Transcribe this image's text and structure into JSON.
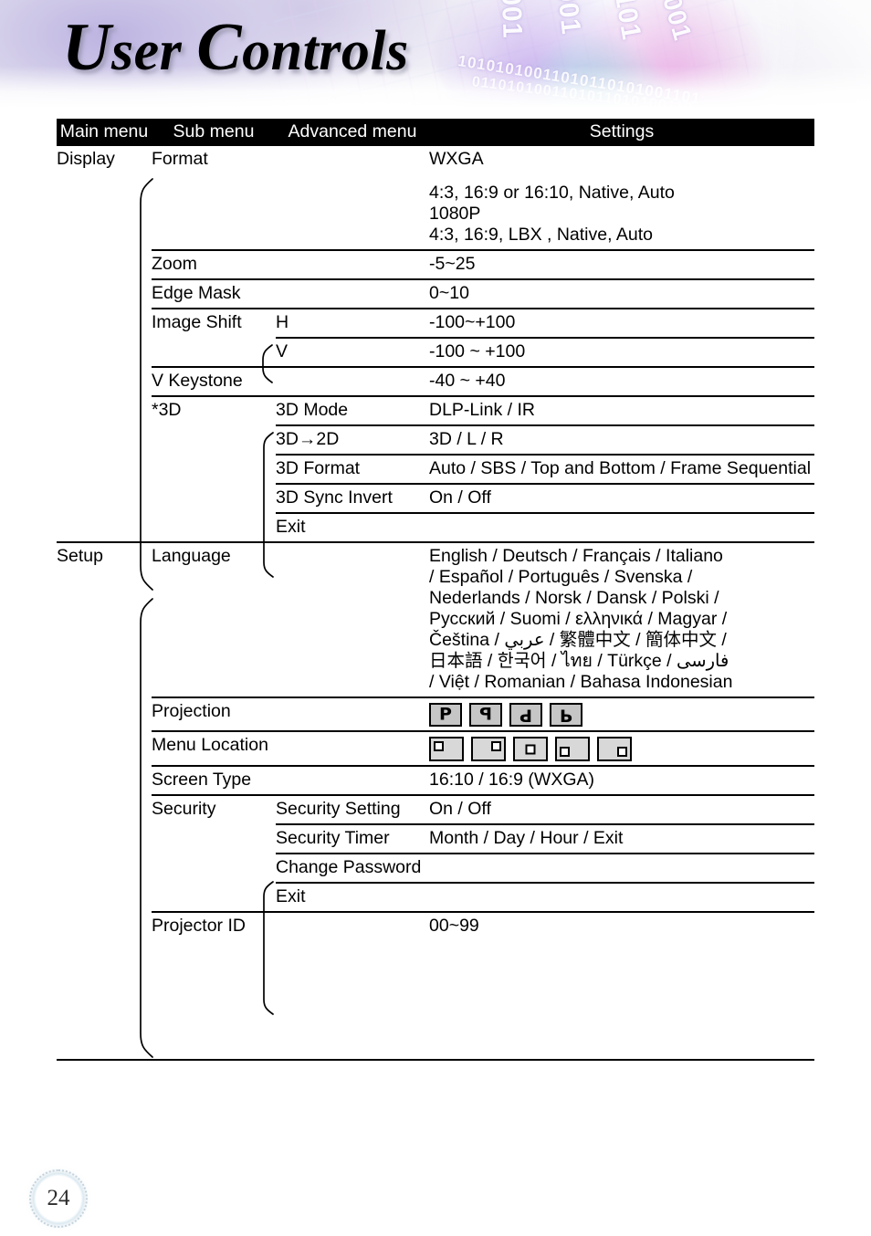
{
  "page": {
    "title": "User Controls",
    "title_cap_1": "U",
    "title_rest_1": "ser ",
    "title_cap_2": "C",
    "title_rest_2": "ontrols",
    "number": "24"
  },
  "table": {
    "headers": {
      "main": "Main menu",
      "sub": "Sub menu",
      "advanced": "Advanced menu",
      "settings": "Settings"
    },
    "sections": [
      {
        "main": "Display",
        "rows": [
          {
            "sub": "Format",
            "adv": "",
            "settings_lines": [
              "WXGA",
              "4:3, 16:9 or 16:10, Native, Auto",
              "1080P",
              "4:3, 16:9, LBX , Native, Auto"
            ]
          },
          {
            "sub": "Zoom",
            "adv": "",
            "settings_lines": [
              "-5~25"
            ]
          },
          {
            "sub": "Edge Mask",
            "adv": "",
            "settings_lines": [
              "0~10"
            ]
          },
          {
            "sub": "Image Shift",
            "adv": "H",
            "settings_lines": [
              "-100~+100"
            ]
          },
          {
            "sub": "",
            "adv": "V",
            "settings_lines": [
              "-100 ~ +100"
            ]
          },
          {
            "sub": "V Keystone",
            "adv": "",
            "settings_lines": [
              "-40 ~ +40"
            ]
          },
          {
            "sub": "*3D",
            "adv": "3D Mode",
            "settings_lines": [
              "DLP-Link / IR"
            ]
          },
          {
            "sub": "",
            "adv": "3D→2D",
            "settings_lines": [
              "3D / L / R"
            ]
          },
          {
            "sub": "",
            "adv": "3D Format",
            "settings_lines": [
              "Auto / SBS / Top and Bottom / Frame Sequential"
            ]
          },
          {
            "sub": "",
            "adv": "3D Sync Invert",
            "settings_lines": [
              "On / Off"
            ]
          },
          {
            "sub": "",
            "adv": "Exit",
            "settings_lines": []
          }
        ]
      },
      {
        "main": "Setup",
        "rows": [
          {
            "sub": "Language",
            "adv": "",
            "settings_lines": [
              "English / Deutsch / Français / Italiano",
              "/ Español / Português / Svenska /",
              "Nederlands / Norsk / Dansk / Polski /",
              "Русский / Suomi / ελληνικά / Magyar /",
              "Čeština / عربي / 繁體中文 / 簡体中文 /",
              "日本語 / 한국어 / ไทย / Türkçe / فارسی",
              "/ Việt / Romanian / Bahasa Indonesian"
            ]
          },
          {
            "sub": "Projection",
            "adv": "",
            "settings_icons": "projection"
          },
          {
            "sub": "Menu Location",
            "adv": "",
            "settings_icons": "menu-location"
          },
          {
            "sub": "Screen Type",
            "adv": "",
            "settings_lines": [
              "16:10 / 16:9 (WXGA)"
            ]
          },
          {
            "sub": "Security",
            "adv": "Security Setting",
            "settings_lines": [
              "On / Off"
            ]
          },
          {
            "sub": "",
            "adv": "Security Timer",
            "settings_lines": [
              "Month / Day / Hour / Exit"
            ]
          },
          {
            "sub": "",
            "adv": "Change Password",
            "settings_lines": []
          },
          {
            "sub": "",
            "adv": "Exit",
            "settings_lines": []
          },
          {
            "sub": "Projector ID",
            "adv": "",
            "settings_lines": [
              "00~99"
            ]
          }
        ]
      }
    ]
  },
  "icons": {
    "projection": [
      {
        "name": "projection-front-desktop",
        "glyph": "P",
        "flip": ""
      },
      {
        "name": "projection-rear-desktop",
        "glyph": "P",
        "flip": "flipH"
      },
      {
        "name": "projection-front-ceiling",
        "glyph": "P",
        "flip": "flipHV"
      },
      {
        "name": "projection-rear-ceiling",
        "glyph": "P",
        "flip": "flipV"
      }
    ],
    "menu_location": [
      {
        "name": "menu-location-top-left",
        "pos": "loc-tl"
      },
      {
        "name": "menu-location-top-right",
        "pos": "loc-tr"
      },
      {
        "name": "menu-location-center",
        "pos": "loc-c"
      },
      {
        "name": "menu-location-bottom-left",
        "pos": "loc-bl"
      },
      {
        "name": "menu-location-bottom-right",
        "pos": "loc-br"
      }
    ]
  },
  "colors": {
    "header_bg": "#000000",
    "header_text": "#ffffff",
    "rule": "#000000",
    "icon_fill": "#c6c6c6",
    "page_ring": "#a9cddd"
  }
}
